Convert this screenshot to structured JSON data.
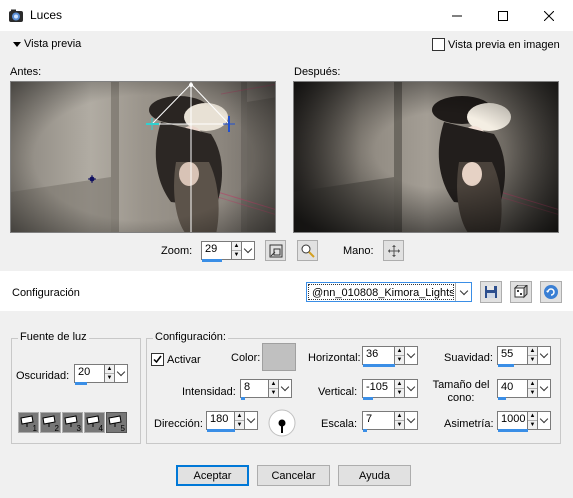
{
  "window": {
    "title": "Luces",
    "minimize_icon": "minimize-icon",
    "maximize_icon": "maximize-icon",
    "close_icon": "close-icon"
  },
  "preview": {
    "toggle_label": "Vista previa",
    "image_preview_label": "Vista previa en imagen",
    "image_preview_checked": false,
    "before_label": "Antes:",
    "after_label": "Después:"
  },
  "zoom": {
    "label": "Zoom:",
    "value": "29",
    "hand_label": "Mano:"
  },
  "config": {
    "label": "Configuración",
    "preset": "@nn_010808_Kimora_Lights...",
    "accent": "#0078d7"
  },
  "light_source": {
    "group_title": "Fuente de luz",
    "darkness_label": "Oscuridad:",
    "darkness_value": "20",
    "lights": [
      "1",
      "2",
      "3",
      "4",
      "5"
    ]
  },
  "settings": {
    "group_title": "Configuración:",
    "activate_label": "Activar",
    "activate_checked": true,
    "color_label": "Color:",
    "color_value": "#c0c0c0",
    "intensity_label": "Intensidad:",
    "intensity_value": "8",
    "direction_label": "Dirección:",
    "direction_value": "180",
    "horizontal_label": "Horizontal:",
    "horizontal_value": "36",
    "vertical_label": "Vertical:",
    "vertical_value": "-105",
    "scale_label": "Escala:",
    "scale_value": "7",
    "smoothness_label": "Suavidad:",
    "smoothness_value": "55",
    "cone_size_label": "Tamaño del cono:",
    "cone_size_value": "40",
    "asymmetry_label": "Asimetría:",
    "asymmetry_value": "1000"
  },
  "buttons": {
    "ok": "Aceptar",
    "cancel": "Cancelar",
    "help": "Ayuda"
  }
}
